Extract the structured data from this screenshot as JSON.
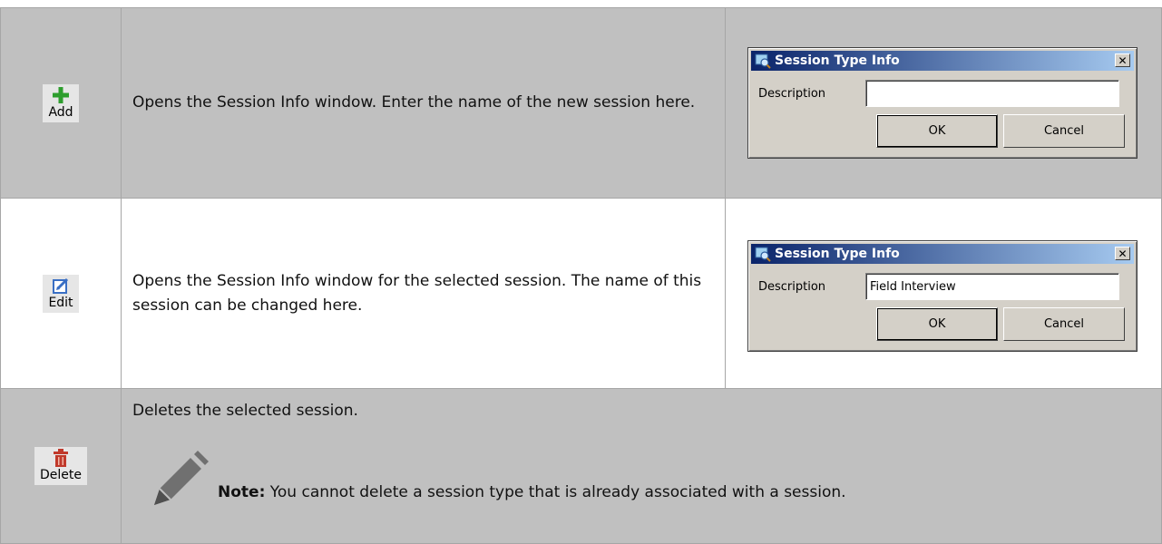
{
  "rows": {
    "add": {
      "button_label": "Add",
      "description": "Opens the Session Info window. Enter the name of the new session here.",
      "dialog": {
        "title": "Session Type Info",
        "close_glyph": "✕",
        "field_label": "Description",
        "field_value": "",
        "ok_label": "OK",
        "cancel_label": "Cancel"
      }
    },
    "edit": {
      "button_label": "Edit",
      "description": "Opens the Session Info window for the selected session. The name of this session can be changed here.",
      "dialog": {
        "title": "Session Type Info",
        "close_glyph": "✕",
        "field_label": "Description",
        "field_value": "Field Interview",
        "ok_label": "OK",
        "cancel_label": "Cancel"
      }
    },
    "delete": {
      "button_label": "Delete",
      "description": "Deletes the selected session.",
      "note_label": "Note:",
      "note_text": " You cannot delete a session type that is already associated with a session."
    }
  },
  "icons": {
    "add": "plus-icon",
    "edit": "edit-pencil-icon",
    "delete": "trash-icon",
    "note": "pencil-note-icon",
    "dialog": "session-window-icon",
    "close": "close-icon"
  },
  "colors": {
    "shaded_row": "#c0c0c0",
    "titlebar_start": "#0a246a",
    "titlebar_end": "#a6caf0",
    "dialog_face": "#d4d0c8",
    "add_icon_green": "#2e9e2e",
    "edit_icon_blue": "#3a6fc4",
    "delete_icon_red": "#c0392b"
  }
}
